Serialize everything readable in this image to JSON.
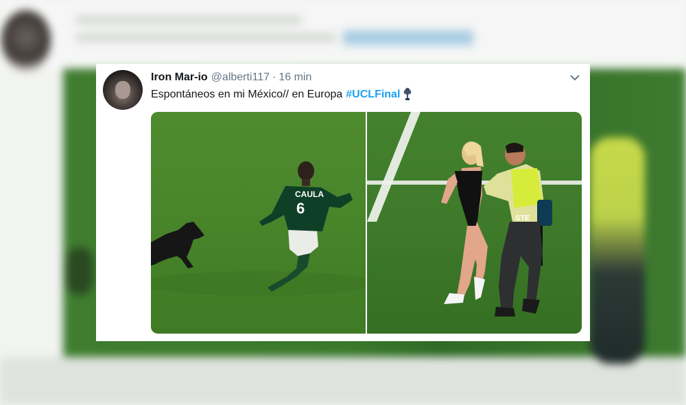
{
  "tweet": {
    "author_name": "Iron Mar-io",
    "author_handle": "@alberti117",
    "separator": "·",
    "timestamp": "16 min",
    "text": "Espontáneos en mi México// en Europa",
    "hashtag": "#UCLFinal",
    "trophy_icon": "ucl-trophy-icon",
    "hashtag_color": "#1da1f2"
  },
  "media": {
    "left_image": {
      "shirt_text": "CAULA",
      "shirt_number": "6"
    },
    "right_image": {
      "vest_text": "STE"
    }
  }
}
